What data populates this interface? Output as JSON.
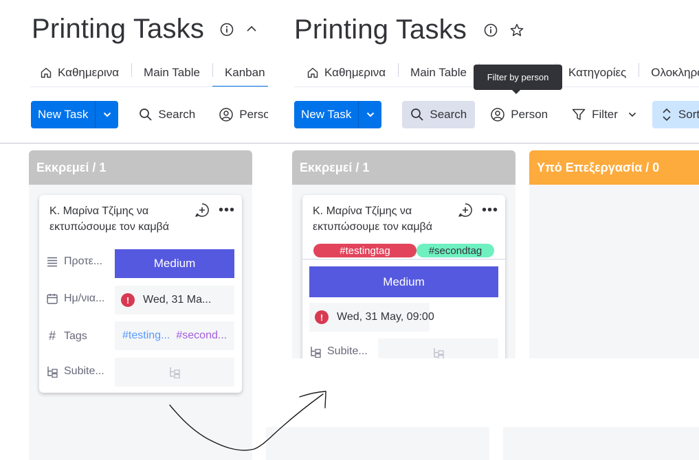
{
  "board": {
    "title": "Printing Tasks"
  },
  "tabs": [
    {
      "label": "Καθημερινα"
    },
    {
      "label": "Main Table"
    },
    {
      "label": "Kanban"
    },
    {
      "label": "Κατηγορίες"
    },
    {
      "label": "Ολοκληρωμένα"
    }
  ],
  "toolbar": {
    "new_task": "New Task",
    "search": "Search",
    "person": "Person",
    "filter": "Filter",
    "sort": "Sort"
  },
  "tooltip": "Filter by person",
  "columns": [
    {
      "title": "Εκκρεμεί / 1",
      "color": "#c4c4c4"
    },
    {
      "title": "Υπό Επεξεργασία / 0",
      "color": "#fdab3d"
    }
  ],
  "card": {
    "title": "Κ. Μαρίνα Τζίμης να εκτυπώσουμε τον καμβά",
    "priority_label": "Προτε...",
    "priority_value": "Medium",
    "priority_color": "#5559df",
    "date_label": "Ημ/νια...",
    "date_value_short": "Wed, 31 Ma...",
    "date_value_full": "Wed, 31 May, 09:00",
    "tags_label": "Tags",
    "tag1_short": "#testing...",
    "tag2_short": "#second...",
    "tag1": "#testingtag",
    "tag2": "#secondtag",
    "tag1_color": "#e2445c",
    "tag2_color": "#6ef0c1",
    "subitems_label": "Subite..."
  }
}
